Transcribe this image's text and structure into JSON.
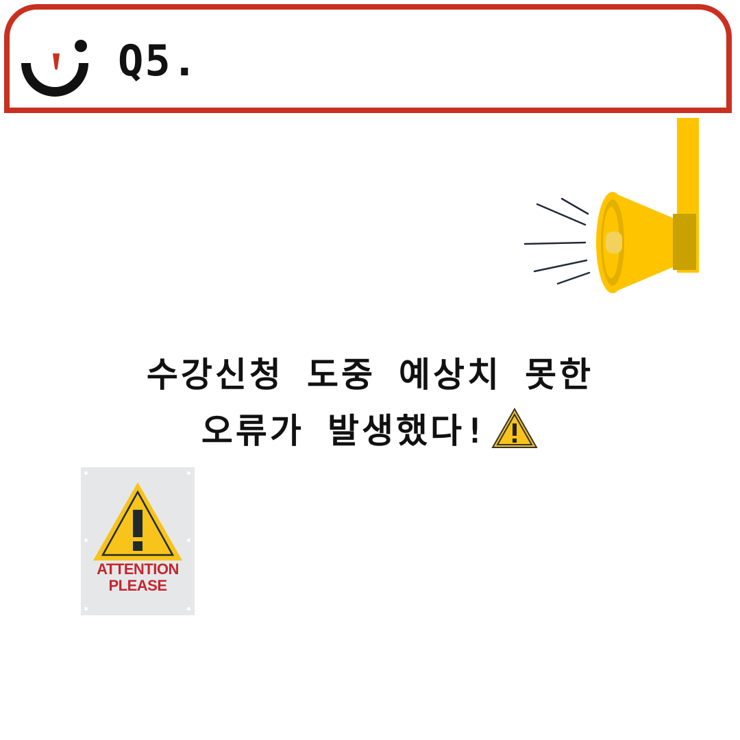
{
  "header": {
    "question_label": "Q5."
  },
  "message": {
    "line_1": "수강신청 도중 예상치 못한",
    "line_2": "오류가 발생했다!"
  },
  "sign": {
    "line_1": "ATTENTION",
    "line_2": "PLEASE"
  },
  "icons": {
    "logo": "smile-logo-icon",
    "megaphone": "megaphone-icon",
    "inline_warning": "warning-triangle-icon",
    "sign_warning": "warning-triangle-icon"
  },
  "colors": {
    "header_border": "#c9301f",
    "megaphone_yellow": "#ffc400",
    "warning_yellow": "#f8c31a",
    "sign_text": "#c4262e",
    "sign_background": "#e6e7e8"
  }
}
